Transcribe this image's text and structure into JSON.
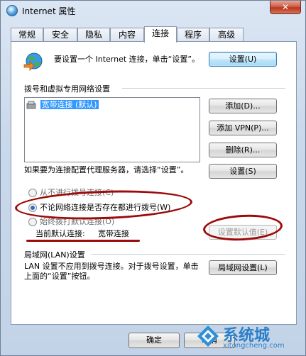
{
  "window": {
    "title": "Internet 属性",
    "close_label": "✕"
  },
  "tabs": [
    {
      "label": "常规"
    },
    {
      "label": "安全"
    },
    {
      "label": "隐私"
    },
    {
      "label": "内容"
    },
    {
      "label": "连接"
    },
    {
      "label": "程序"
    },
    {
      "label": "高级"
    }
  ],
  "setup": {
    "text": "要设置一个 Internet 连接，单击“设置”。",
    "button": "设置(U)"
  },
  "dialup": {
    "section_title": "拨号和虚拟专用网络设置",
    "list_items": [
      "宽带连接 (默认)"
    ],
    "add_button": "添加(D)...",
    "add_vpn_button": "添加 VPN(P)...",
    "delete_button": "删除(R)...",
    "proxy_text": "如果要为连接配置代理服务器，请选择“设置”。",
    "settings_button": "设置(S)",
    "radio_never": "从不进行拨号连接(C)",
    "radio_always": "不论网络连接是否存在都进行拨号(W)",
    "radio_when_none": "始终拨打默认连接(O)",
    "current_default_label": "当前默认连接:",
    "current_default_value": "宽带连接",
    "set_default_button": "设置默认值(E)"
  },
  "lan": {
    "section_title": "局域网(LAN)设置",
    "text": "LAN 设置不应用到拨号连接。对于拨号设置，单击上面的“设置”按钮。",
    "button": "局域网设置(L)"
  },
  "footer": {
    "ok_button": "确定",
    "cancel_button": "取消"
  },
  "watermark": {
    "brand": "系统城",
    "url": "xitongcheng.com"
  },
  "colors": {
    "annotation": "#9c0a0a",
    "accent": "#2a6fc9"
  }
}
